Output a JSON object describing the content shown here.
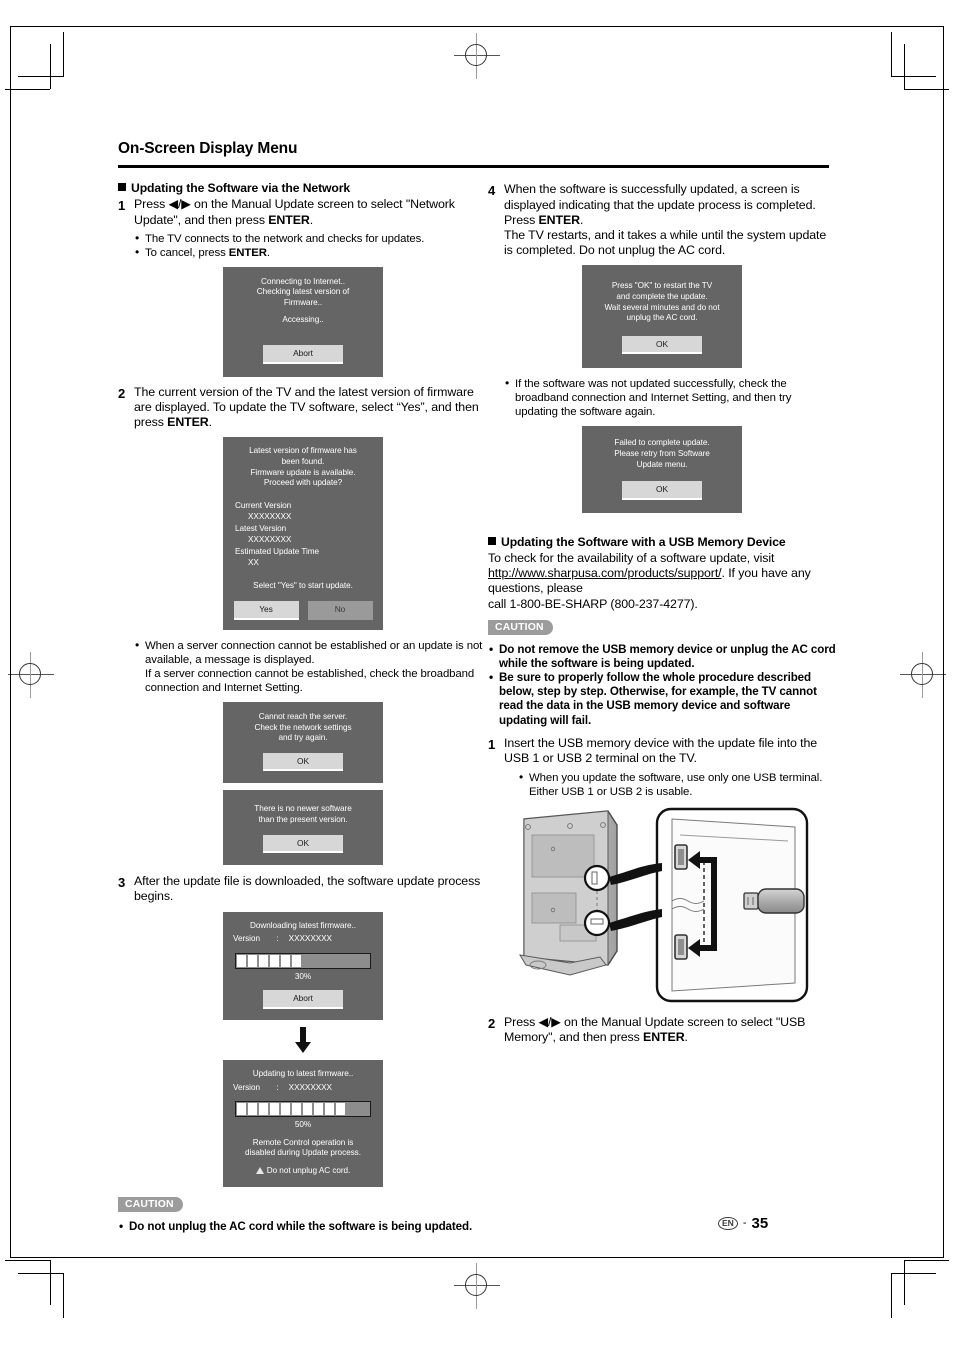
{
  "page": {
    "title": "On-Screen Display Menu",
    "footer_lang": "EN",
    "footer_dash": "-",
    "footer_page": "35"
  },
  "left": {
    "section_heading": "Updating the Software via the Network",
    "step1": {
      "num": "1",
      "text_a": "Press ",
      "arrows": "◀/▶",
      "text_b": " on the Manual Update screen to select \"Network Update\", and then press ",
      "bold": "ENTER",
      "text_c": ".",
      "bullets": [
        "The TV connects to the network and checks for updates.",
        "To cancel, press ENTER."
      ],
      "bullet2_plain": "To cancel, press ",
      "bullet2_bold": "ENTER",
      "bullet2_end": "."
    },
    "dialog_connecting": {
      "line1": "Connecting to Internet..\nChecking latest version of\nFirmware..",
      "line2": "Accessing..",
      "button": "Abort"
    },
    "step2": {
      "num": "2",
      "text_a": "The current version of the TV and the latest version of firmware are displayed. To update the TV software, select “Yes”, and then press ",
      "bold": "ENTER",
      "text_c": "."
    },
    "dialog_firmware_found": {
      "header": "Latest version of firmware has\nbeen found.\nFirmware update is available.\nProceed with update?",
      "label_current": "Current Version",
      "value_current": "XXXXXXXX",
      "label_latest": "Latest Version",
      "value_latest": "XXXXXXXX",
      "label_time": "Estimated Update Time",
      "value_time": "XX",
      "prompt": "Select \"Yes\" to start update.",
      "btn_yes": "Yes",
      "btn_no": "No"
    },
    "note_server": "When a server connection cannot be established or an update is not available, a message is displayed.\nIf a server connection cannot be established, check the broadband connection and Internet Setting.",
    "dialog_cannot_reach": {
      "message": "Cannot reach the server.\nCheck the network settings\nand try again.",
      "button": "OK"
    },
    "dialog_no_newer": {
      "message": "There is no newer software\nthan the present version.",
      "button": "OK"
    },
    "step3": {
      "num": "3",
      "text": "After the update file is downloaded, the software update process begins."
    },
    "dialog_downloading": {
      "title": "Downloading latest firmware..",
      "version_label": "Version",
      "version_colon": ":",
      "version_value": "XXXXXXXX",
      "progress_pct": "30%",
      "progress_segments": 6,
      "progress_total": 20,
      "button": "Abort"
    },
    "dialog_updating": {
      "title": "Updating to latest firmware..",
      "version_label": "Version",
      "version_colon": ":",
      "version_value": "XXXXXXXX",
      "progress_pct": "50%",
      "progress_segments": 10,
      "progress_total": 20,
      "note": "Remote Control operation is\ndisabled during Update process.",
      "warning": "Do not unplug AC cord."
    },
    "caution_label": "CAUTION",
    "caution_text": "Do not unplug the AC cord while the software is being updated."
  },
  "right": {
    "step4": {
      "num": "4",
      "text_a": "When the software is successfully updated, a screen is displayed indicating that the update process is completed.\nPress ",
      "bold": "ENTER",
      "text_b": ".\nThe TV restarts, and it takes a while until the system update is completed. Do not unplug the AC cord."
    },
    "dialog_restart": {
      "message": "Press \"OK\" to restart the TV\nand complete the update.\nWait several minutes and do not\nunplug the AC cord.",
      "button": "OK"
    },
    "note_failed": "If the software was not updated successfully, check the broadband connection and Internet Setting, and then try updating the software again.",
    "dialog_failed": {
      "message": "Failed to complete update.\nPlease retry from Software\nUpdate menu.",
      "button": "OK"
    },
    "section_heading": "Updating the Software with a USB Memory Device",
    "intro_a": "To check for the availability of a software update, visit ",
    "intro_url": "http://www.sharpusa.com/products/support/",
    "intro_b": ". If you have any questions, please",
    "intro_c": "call 1-800-BE-SHARP (800-237-4277).",
    "caution_label": "CAUTION",
    "caution_bullets": [
      "Do not remove the USB memory device or unplug the AC cord while the software is being updated.",
      "Be sure to properly follow the whole procedure described below, step by step. Otherwise, for example, the TV cannot read the data in the USB memory device and software updating will fail."
    ],
    "step1": {
      "num": "1",
      "text": "Insert the USB memory device with the update file into the USB 1 or USB 2 terminal on the TV.",
      "bullets": [
        "When you update the software, use only one USB terminal. Either USB 1 or USB 2 is usable."
      ]
    },
    "illustration_caption": "TV rear panel with USB 1 and USB 2 terminals and a USB memory device",
    "step2": {
      "num": "2",
      "text_a": "Press ",
      "arrows": "◀/▶",
      "text_b": " on the Manual Update screen to select \"USB Memory\", and then press ",
      "bold": "ENTER",
      "text_c": "."
    }
  }
}
